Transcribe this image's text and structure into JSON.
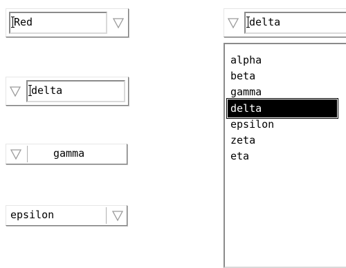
{
  "combo_color": {
    "value": "Red"
  },
  "combo_left_arrow": {
    "value": "delta"
  },
  "combo_gamma": {
    "value": "gamma"
  },
  "combo_epsilon": {
    "value": "epsilon"
  },
  "combo_open": {
    "value": "delta",
    "options": [
      "alpha",
      "beta",
      "gamma",
      "delta",
      "epsilon",
      "zeta",
      "eta"
    ],
    "selected": "delta"
  }
}
